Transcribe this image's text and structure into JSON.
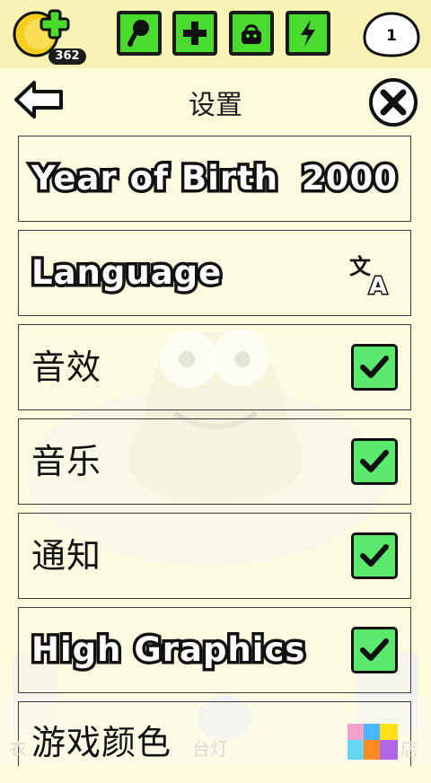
{
  "topbar": {
    "coins": "362",
    "buttons": [
      {
        "name": "food-button",
        "icon": "drumstick-icon"
      },
      {
        "name": "potion-button",
        "icon": "plus-icon"
      },
      {
        "name": "shop-button",
        "icon": "bag-icon"
      },
      {
        "name": "energy-button",
        "icon": "lightning-icon"
      }
    ],
    "level": "1",
    "accent": "#49dc2f"
  },
  "header": {
    "title": "设置",
    "back_icon": "arrow-left-icon",
    "close_icon": "close-icon"
  },
  "settings": [
    {
      "label": "Year of Birth",
      "value": "2000"
    },
    {
      "label": "Language",
      "icon": "translate-icon"
    },
    {
      "label": "音效",
      "checked": true
    },
    {
      "label": "音乐",
      "checked": true
    },
    {
      "label": "通知",
      "checked": true
    },
    {
      "label": "High Graphics",
      "checked": true
    },
    {
      "label": "游戏颜色",
      "icon": "color-palette-icon"
    }
  ],
  "bottom_ghost_text": {
    "left": "衣",
    "middle": "台灯",
    "right": "店"
  },
  "colors": {
    "check_green": "#5ae86d",
    "background": "#fdfbdc"
  }
}
